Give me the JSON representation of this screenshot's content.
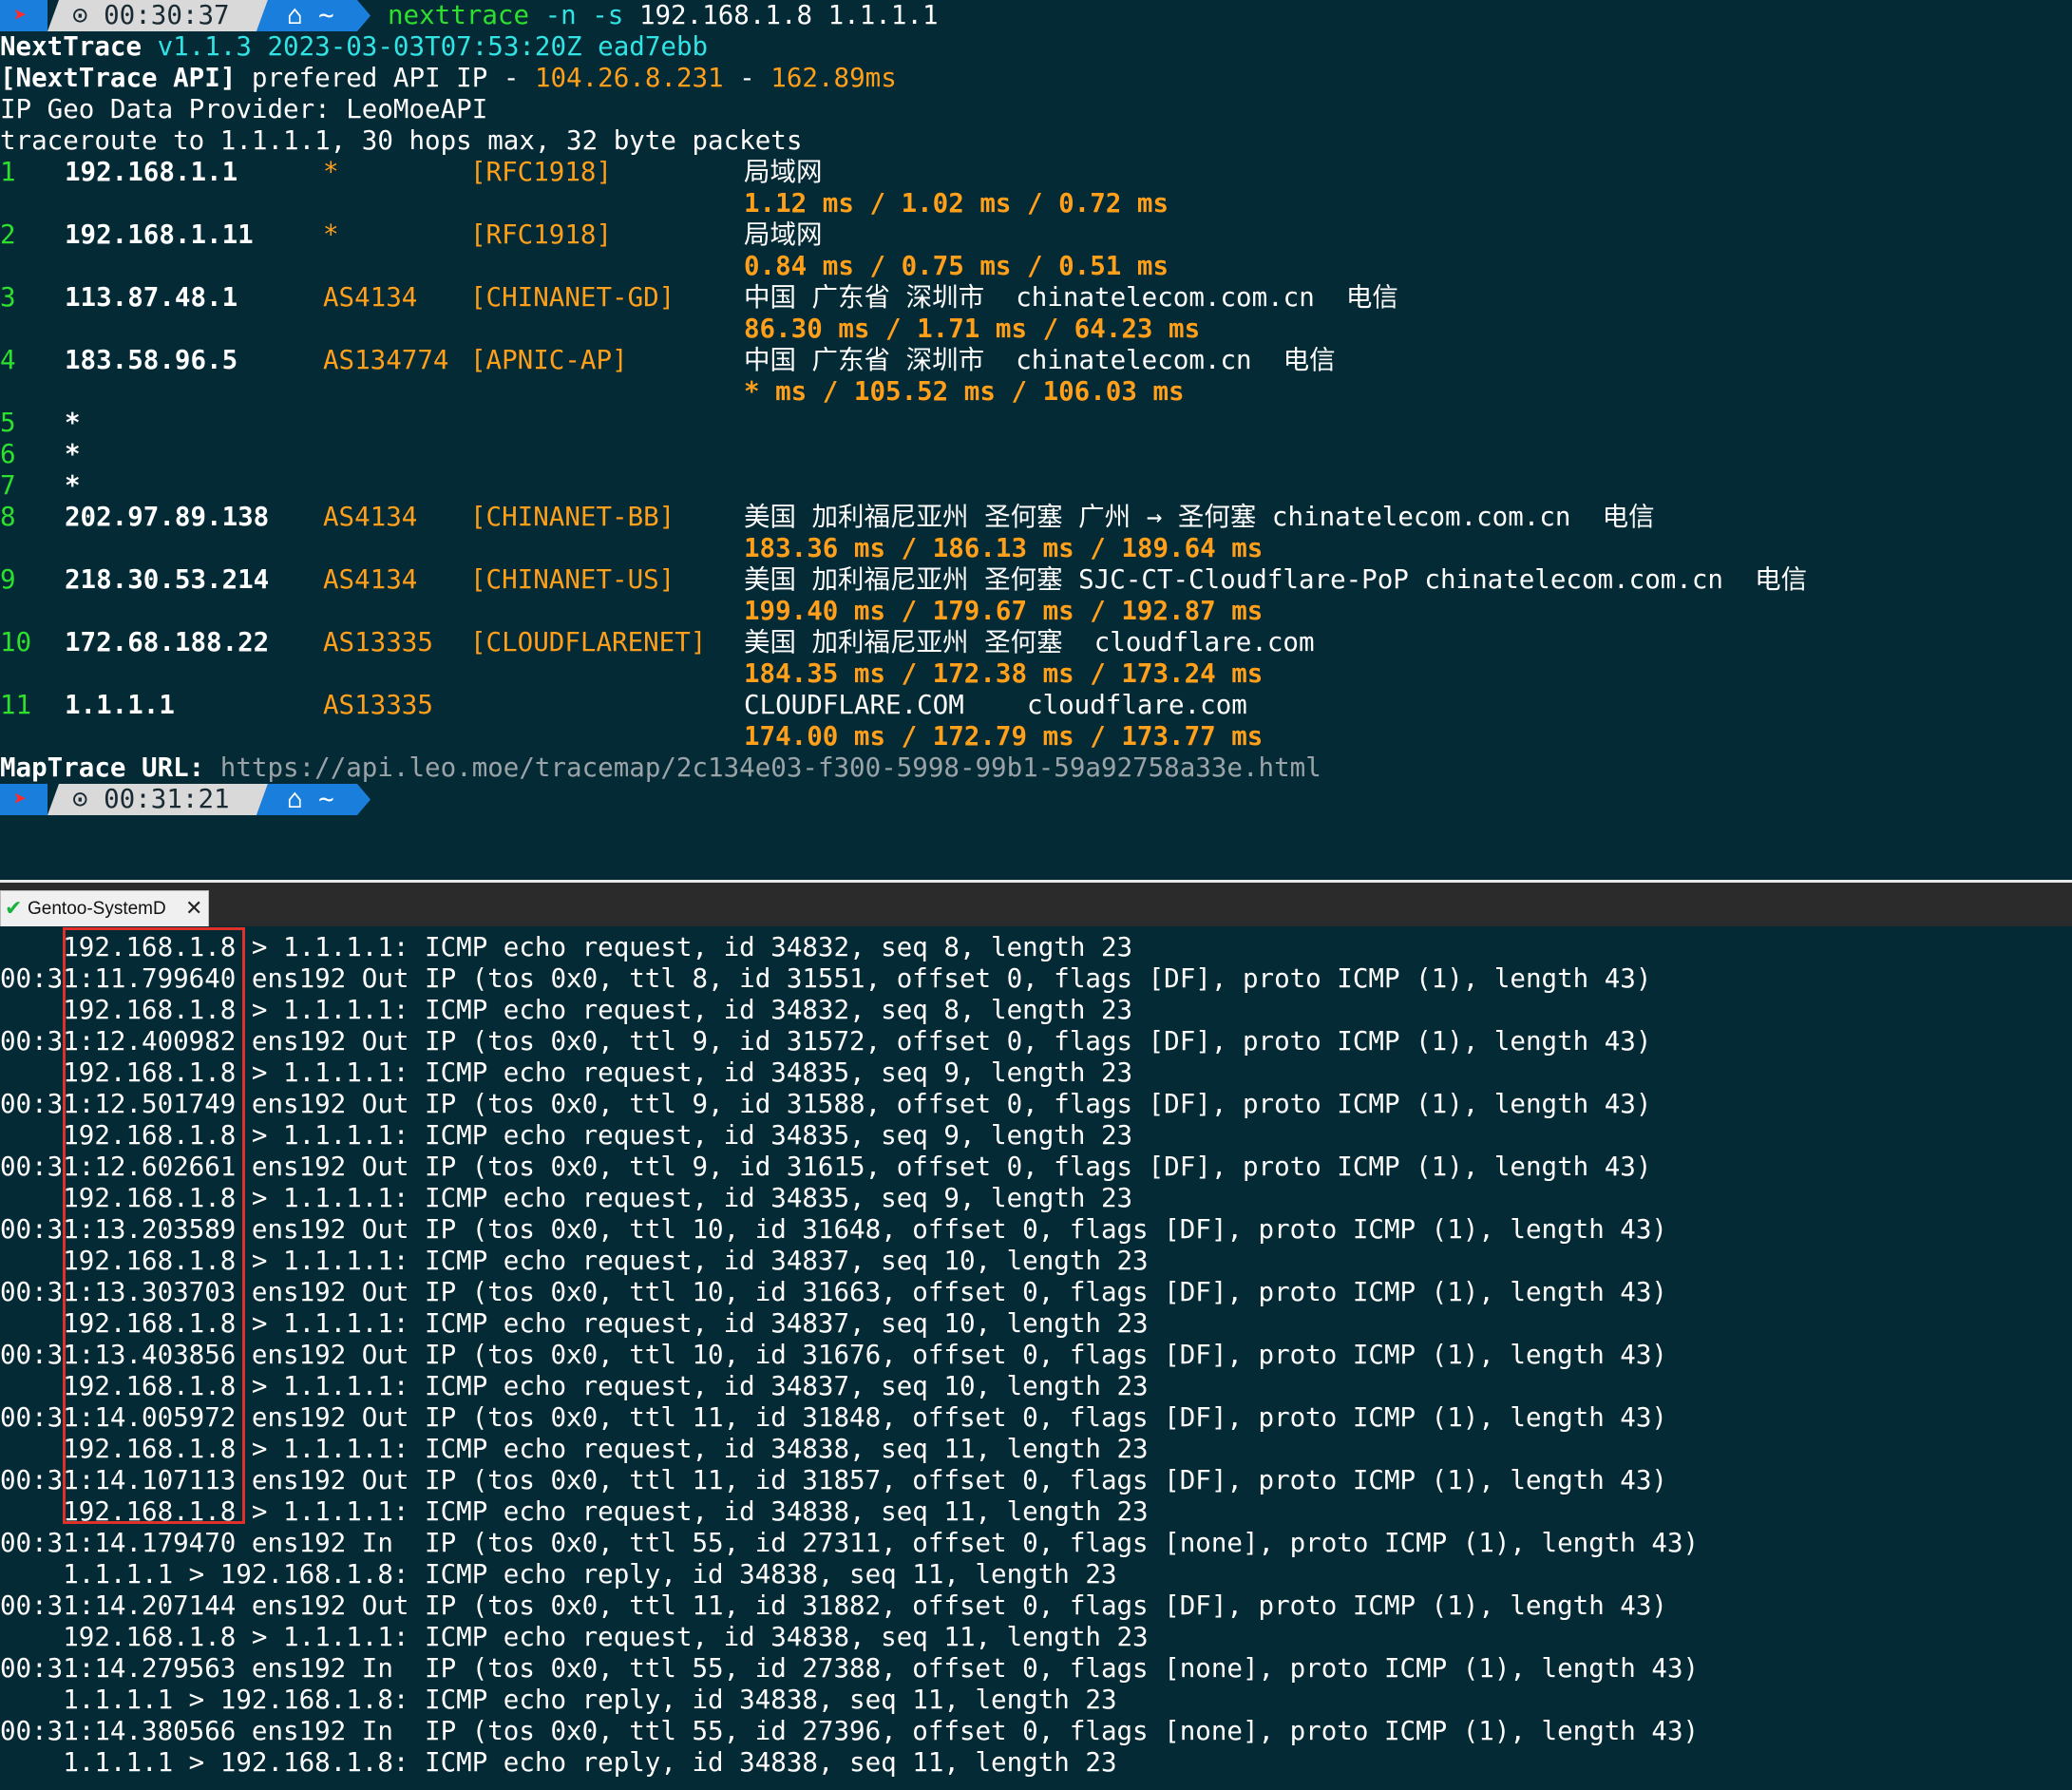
{
  "prompt1": {
    "time": "⊙ 00:30:37",
    "home": "⌂ ~",
    "cmd": "nexttrace",
    "flags": "-n -s",
    "args": "192.168.1.8 1.1.1.1"
  },
  "header": {
    "name": "NextTrace",
    "ver": "v1.1.3 2023-03-03T07:53:20Z ead7ebb",
    "api_tag": "[NextTrace API]",
    "api_text": " prefered API IP - ",
    "api_ip": "104.26.8.231",
    "api_sep": " - ",
    "api_ms": "162.89ms",
    "geo": "IP Geo Data Provider: LeoMoeAPI",
    "route": "traceroute to 1.1.1.1, 30 hops max, 32 byte packets"
  },
  "hops": [
    {
      "n": "1",
      "ip": "192.168.1.1",
      "as": "*",
      "tag": "[RFC1918]",
      "geo": "局域网",
      "rtt": "1.12 ms / 1.02 ms / 0.72 ms"
    },
    {
      "n": "2",
      "ip": "192.168.1.11",
      "as": "*",
      "tag": "[RFC1918]",
      "geo": "局域网",
      "rtt": "0.84 ms / 0.75 ms / 0.51 ms"
    },
    {
      "n": "3",
      "ip": "113.87.48.1",
      "as": "AS4134",
      "tag": "[CHINANET-GD]",
      "geo": "中国 广东省 深圳市  chinatelecom.com.cn  电信",
      "rtt": "86.30 ms / 1.71 ms / 64.23 ms"
    },
    {
      "n": "4",
      "ip": "183.58.96.5",
      "as": "AS134774",
      "tag": "[APNIC-AP]",
      "geo": "中国 广东省 深圳市  chinatelecom.cn  电信",
      "rtt": "* ms / 105.52 ms / 106.03 ms"
    },
    {
      "n": "5",
      "ip": "*"
    },
    {
      "n": "6",
      "ip": "*"
    },
    {
      "n": "7",
      "ip": "*"
    },
    {
      "n": "8",
      "ip": "202.97.89.138",
      "as": "AS4134",
      "tag": "[CHINANET-BB]",
      "geo": "美国 加利福尼亚州 圣何塞 广州 → 圣何塞 chinatelecom.com.cn  电信",
      "rtt": "183.36 ms / 186.13 ms / 189.64 ms"
    },
    {
      "n": "9",
      "ip": "218.30.53.214",
      "as": "AS4134",
      "tag": "[CHINANET-US]",
      "geo": "美国 加利福尼亚州 圣何塞 SJC-CT-Cloudflare-PoP chinatelecom.com.cn  电信",
      "rtt": "199.40 ms / 179.67 ms / 192.87 ms"
    },
    {
      "n": "10",
      "ip": "172.68.188.22",
      "as": "AS13335",
      "tag": "[CLOUDFLARENET]",
      "geo": "美国 加利福尼亚州 圣何塞  cloudflare.com",
      "rtt": "184.35 ms / 172.38 ms / 173.24 ms"
    },
    {
      "n": "11",
      "ip": "1.1.1.1",
      "as": "AS13335",
      "tag": "",
      "geo": "CLOUDFLARE.COM    cloudflare.com",
      "rtt": "174.00 ms / 172.79 ms / 173.77 ms"
    }
  ],
  "maptrace": {
    "label": "MapTrace URL:",
    "url": "https://api.leo.moe/tracemap/2c134e03-f300-5998-99b1-59a92758a33e.html"
  },
  "prompt2": {
    "time": "⊙ 00:31:21",
    "home": "⌂ ~"
  },
  "tab": {
    "name": "Gentoo-SystemD",
    "close": "✕"
  },
  "tcpdump": [
    "    192.168.1.8 > 1.1.1.1: ICMP echo request, id 34832, seq 8, length 23",
    "00:31:11.799640 ens192 Out IP (tos 0x0, ttl 8, id 31551, offset 0, flags [DF], proto ICMP (1), length 43)",
    "    192.168.1.8 > 1.1.1.1: ICMP echo request, id 34832, seq 8, length 23",
    "00:31:12.400982 ens192 Out IP (tos 0x0, ttl 9, id 31572, offset 0, flags [DF], proto ICMP (1), length 43)",
    "    192.168.1.8 > 1.1.1.1: ICMP echo request, id 34835, seq 9, length 23",
    "00:31:12.501749 ens192 Out IP (tos 0x0, ttl 9, id 31588, offset 0, flags [DF], proto ICMP (1), length 43)",
    "    192.168.1.8 > 1.1.1.1: ICMP echo request, id 34835, seq 9, length 23",
    "00:31:12.602661 ens192 Out IP (tos 0x0, ttl 9, id 31615, offset 0, flags [DF], proto ICMP (1), length 43)",
    "    192.168.1.8 > 1.1.1.1: ICMP echo request, id 34835, seq 9, length 23",
    "00:31:13.203589 ens192 Out IP (tos 0x0, ttl 10, id 31648, offset 0, flags [DF], proto ICMP (1), length 43)",
    "    192.168.1.8 > 1.1.1.1: ICMP echo request, id 34837, seq 10, length 23",
    "00:31:13.303703 ens192 Out IP (tos 0x0, ttl 10, id 31663, offset 0, flags [DF], proto ICMP (1), length 43)",
    "    192.168.1.8 > 1.1.1.1: ICMP echo request, id 34837, seq 10, length 23",
    "00:31:13.403856 ens192 Out IP (tos 0x0, ttl 10, id 31676, offset 0, flags [DF], proto ICMP (1), length 43)",
    "    192.168.1.8 > 1.1.1.1: ICMP echo request, id 34837, seq 10, length 23",
    "00:31:14.005972 ens192 Out IP (tos 0x0, ttl 11, id 31848, offset 0, flags [DF], proto ICMP (1), length 43)",
    "    192.168.1.8 > 1.1.1.1: ICMP echo request, id 34838, seq 11, length 23",
    "00:31:14.107113 ens192 Out IP (tos 0x0, ttl 11, id 31857, offset 0, flags [DF], proto ICMP (1), length 43)",
    "    192.168.1.8 > 1.1.1.1: ICMP echo request, id 34838, seq 11, length 23",
    "00:31:14.179470 ens192 In  IP (tos 0x0, ttl 55, id 27311, offset 0, flags [none], proto ICMP (1), length 43)",
    "    1.1.1.1 > 192.168.1.8: ICMP echo reply, id 34838, seq 11, length 23",
    "00:31:14.207144 ens192 Out IP (tos 0x0, ttl 11, id 31882, offset 0, flags [DF], proto ICMP (1), length 43)",
    "    192.168.1.8 > 1.1.1.1: ICMP echo request, id 34838, seq 11, length 23",
    "00:31:14.279563 ens192 In  IP (tos 0x0, ttl 55, id 27388, offset 0, flags [none], proto ICMP (1), length 43)",
    "    1.1.1.1 > 192.168.1.8: ICMP echo reply, id 34838, seq 11, length 23",
    "00:31:14.380566 ens192 In  IP (tos 0x0, ttl 55, id 27396, offset 0, flags [none], proto ICMP (1), length 43)",
    "    1.1.1.1 > 192.168.1.8: ICMP echo reply, id 34838, seq 11, length 23"
  ]
}
